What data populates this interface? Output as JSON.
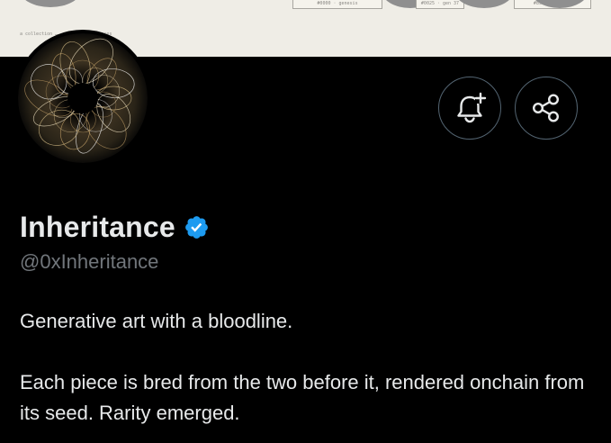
{
  "banner": {
    "tags": [
      "#0000 · genesis",
      "#0025 · gen 37",
      "#8566 · gen 49"
    ],
    "caption": "a collection … — 0 founding houses"
  },
  "profile": {
    "display_name": "Inheritance",
    "handle": "@0xInheritance",
    "verified": true,
    "verified_color": "#1d9bf0",
    "bio": "Generative art with a bloodline.\n\nEach piece is bred from the two before it, rendered onchain from its seed. Rarity emerged."
  },
  "actions": {
    "notify_icon": "bell-plus-icon",
    "share_icon": "share-icon"
  },
  "colors": {
    "background": "#000000",
    "text_primary": "#e7e9ea",
    "text_secondary": "#71767b",
    "button_border": "#536471",
    "banner_background": "#efede6"
  }
}
